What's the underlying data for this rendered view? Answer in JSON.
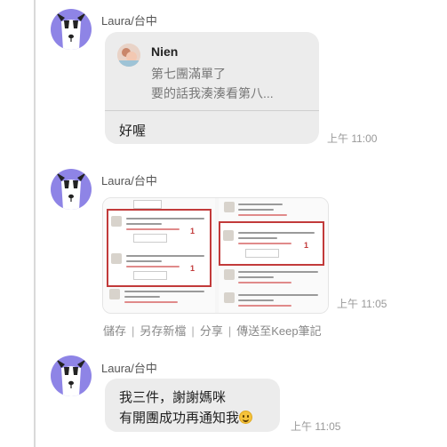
{
  "colors": {
    "avatar_bg": "#8e84e6",
    "bubble_bg": "#ececec",
    "highlight_red": "#c23a3a"
  },
  "messages": [
    {
      "sender": "Laura/台中",
      "avatar_icon": "dog-avatar-icon",
      "reply_to": {
        "name": "Nien",
        "lines": [
          "第七團滿單了",
          "要的話我湊湊看第八..."
        ]
      },
      "text": "好喔",
      "time": "上午 11:00"
    },
    {
      "sender": "Laura/台中",
      "avatar_icon": "dog-avatar-icon",
      "image_type": "order-screenshot",
      "image_quantities": [
        "1",
        "1",
        "1"
      ],
      "time": "上午 11:05"
    },
    {
      "sender": "Laura/台中",
      "avatar_icon": "dog-avatar-icon",
      "text_lines": [
        "我三件，謝謝媽咪",
        "有開團成功再通知我"
      ],
      "emoji_icon": "smiling-face-icon",
      "time": "上午 11:05"
    }
  ],
  "image_actions": [
    "儲存",
    "另存新檔",
    "分享",
    "傳送至Keep筆記"
  ],
  "separator": "|"
}
